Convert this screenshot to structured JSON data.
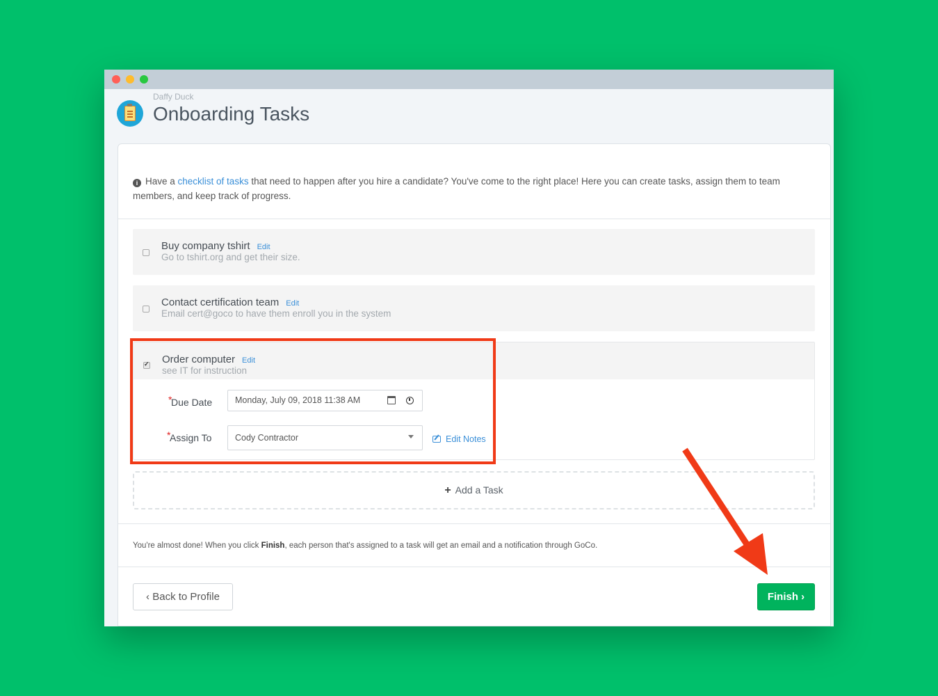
{
  "window": {
    "traffic_lights": [
      "close",
      "minimize",
      "zoom"
    ]
  },
  "header": {
    "subtitle": "Daffy Duck",
    "title": "Onboarding Tasks",
    "icon": "clipboard-icon"
  },
  "intro": {
    "prefix": "Have a ",
    "link": "checklist of tasks",
    "suffix": " that need to happen after you hire a candidate? You've come to the right place! Here you can create tasks, assign them to team members, and keep track of progress."
  },
  "tasks": [
    {
      "title": "Buy company tshirt",
      "edit": "Edit",
      "description": "Go to tshirt.org and get their size.",
      "checked": false
    },
    {
      "title": "Contact certification team",
      "edit": "Edit",
      "description": "Email cert@goco to have them enroll you in the system",
      "checked": false
    },
    {
      "title": "Order computer",
      "edit": "Edit",
      "description": "see IT for instruction",
      "checked": true
    }
  ],
  "task_details": {
    "due_date_label": "Due Date",
    "due_date_value": "Monday, July 09, 2018 11:38 AM",
    "assign_to_label": "Assign To",
    "assign_to_value": "Cody Contractor",
    "edit_notes": "Edit Notes",
    "required_marker": "*"
  },
  "add_task": {
    "plus": "+",
    "label": "Add a Task"
  },
  "footer": {
    "note_prefix": "You're almost done! When you click ",
    "note_bold": "Finish",
    "note_suffix": ", each person that's assigned to a task will get an email and a notification through GoCo.",
    "back_label": "Back to Profile",
    "finish_label": "Finish",
    "back_chevron": "‹",
    "finish_chevron": "›"
  },
  "colors": {
    "background": "#00c06b",
    "accent_link": "#3a8fd8",
    "finish_button": "#00b35d",
    "annotation": "#f03a17"
  }
}
